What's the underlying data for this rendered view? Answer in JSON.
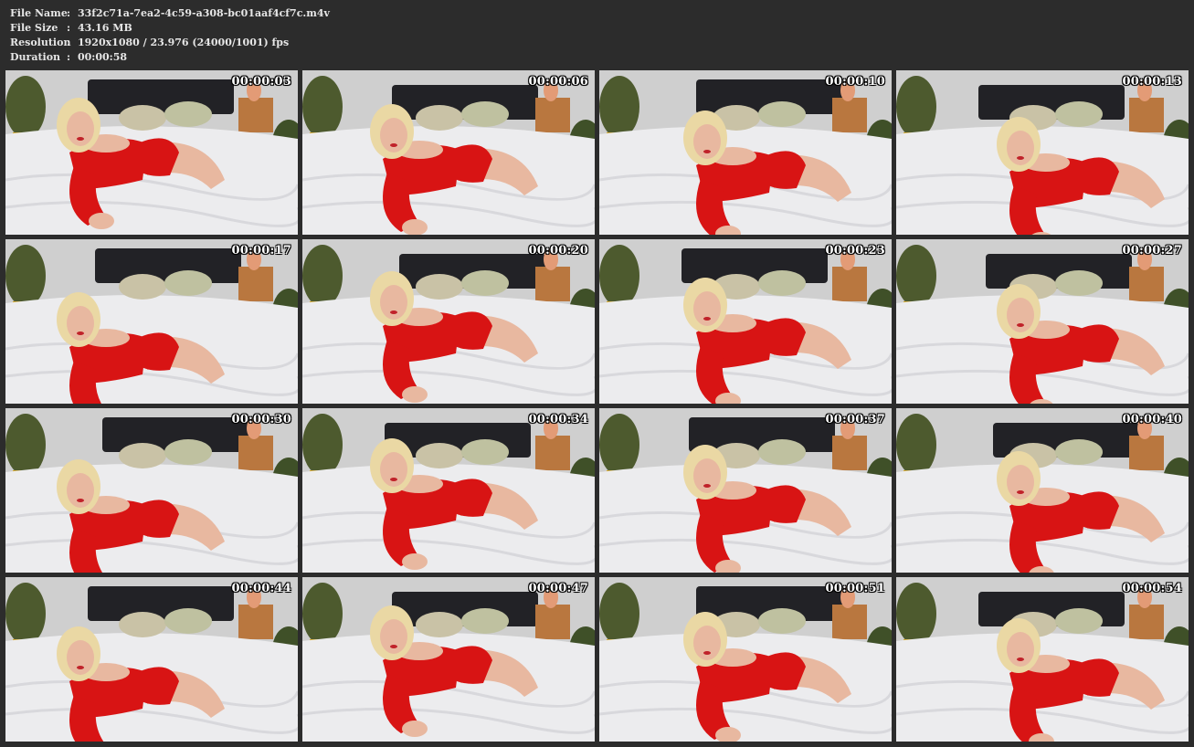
{
  "metadata": [
    {
      "key": "File Name",
      "value": "33f2c71a-7ea2-4c59-a308-bc01aaf4cf7c.m4v"
    },
    {
      "key": "File Size",
      "value": "43.16 MB"
    },
    {
      "key": "Resolution",
      "value": "1920x1080 / 23.976 (24000/1001) fps"
    },
    {
      "key": "Duration",
      "value": "00:00:58"
    }
  ],
  "separator": ":",
  "thumbnails": [
    {
      "timestamp": "00:00:03"
    },
    {
      "timestamp": "00:00:06"
    },
    {
      "timestamp": "00:00:10"
    },
    {
      "timestamp": "00:00:13"
    },
    {
      "timestamp": "00:00:17"
    },
    {
      "timestamp": "00:00:20"
    },
    {
      "timestamp": "00:00:23"
    },
    {
      "timestamp": "00:00:27"
    },
    {
      "timestamp": "00:00:30"
    },
    {
      "timestamp": "00:00:34"
    },
    {
      "timestamp": "00:00:37"
    },
    {
      "timestamp": "00:00:40"
    },
    {
      "timestamp": "00:00:44"
    },
    {
      "timestamp": "00:00:47"
    },
    {
      "timestamp": "00:00:51"
    },
    {
      "timestamp": "00:00:54"
    }
  ],
  "colors": {
    "background": "#2c2c2c",
    "outfit": "#d81414",
    "bedding": "#ececee",
    "wall": "#cfcfcf",
    "headboard": "#222226",
    "hair": "#ead8a4",
    "skin": "#e8b8a0"
  }
}
